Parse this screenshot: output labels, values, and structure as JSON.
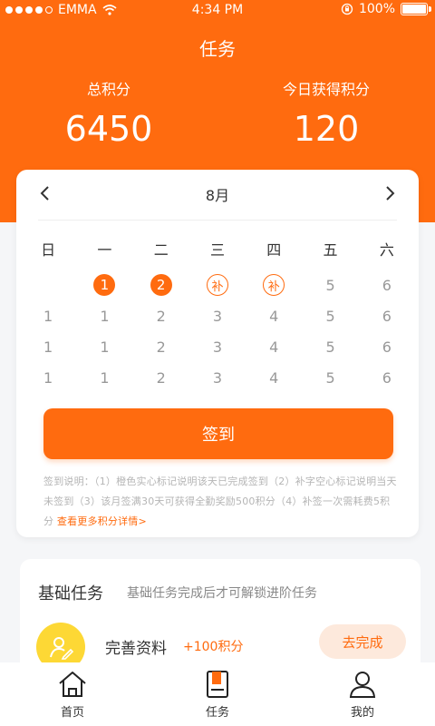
{
  "status_bar": {
    "carrier": "EMMA",
    "time": "4:34 PM",
    "battery": "100%"
  },
  "header": {
    "title": "任务",
    "total_points_label": "总积分",
    "total_points_value": "6450",
    "today_points_label": "今日获得积分",
    "today_points_value": "120"
  },
  "calendar": {
    "month": "8月",
    "weekdays": [
      "日",
      "一",
      "二",
      "三",
      "四",
      "五",
      "六"
    ],
    "rows": [
      [
        "",
        "1",
        "2",
        "补",
        "补",
        "5",
        "6"
      ],
      [
        "1",
        "1",
        "2",
        "3",
        "4",
        "5",
        "6"
      ],
      [
        "1",
        "1",
        "2",
        "3",
        "4",
        "5",
        "6"
      ],
      [
        "1",
        "1",
        "2",
        "3",
        "4",
        "5",
        "6"
      ]
    ],
    "row1_styles": [
      "none",
      "filled",
      "filled",
      "hollow",
      "hollow",
      "none",
      "none"
    ]
  },
  "sign": {
    "button_label": "签到",
    "note": "签到说明：（1）橙色实心标记说明该天已完成签到（2）补字空心标记说明当天未签到（3）该月签满30天可获得全勤奖励500积分（4）补签一次需耗费5积分",
    "more_link": "查看更多积分详情>"
  },
  "tasks": {
    "title": "基础任务",
    "subtitle": "基础任务完成后才可解锁进阶任务",
    "item_name": "完善资料",
    "item_points": "+100积分",
    "item_button": "去完成"
  },
  "tabbar": {
    "home": "首页",
    "tasks": "任务",
    "mine": "我的"
  },
  "colors": {
    "accent": "#ff6b0f",
    "avatar": "#fdd835"
  }
}
